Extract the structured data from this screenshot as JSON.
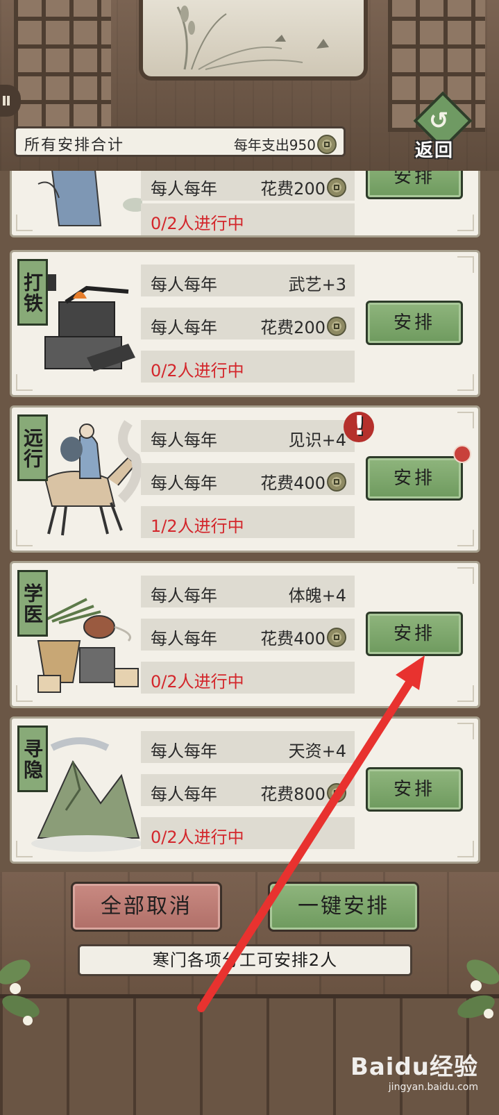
{
  "header": {
    "totals_label": "所有安排合计",
    "totals_expense": "每年支出950",
    "back_label": "返回"
  },
  "cards": [
    {
      "tag": "",
      "rows": [
        {
          "label": "每人每年",
          "value": "花费200"
        }
      ],
      "status": "0/2人进行中",
      "button": "安排"
    },
    {
      "tag": "打铁",
      "rows": [
        {
          "label": "每人每年",
          "value": "武艺+3"
        },
        {
          "label": "每人每年",
          "value": "花费200"
        }
      ],
      "status": "0/2人进行中",
      "button": "安排"
    },
    {
      "tag": "远行",
      "rows": [
        {
          "label": "每人每年",
          "value": "见识+4"
        },
        {
          "label": "每人每年",
          "value": "花费400"
        }
      ],
      "status": "1/2人进行中",
      "button": "安排",
      "alert": "!"
    },
    {
      "tag": "学医",
      "rows": [
        {
          "label": "每人每年",
          "value": "体魄+4"
        },
        {
          "label": "每人每年",
          "value": "花费400"
        }
      ],
      "status": "0/2人进行中",
      "button": "安排"
    },
    {
      "tag": "寻隐",
      "rows": [
        {
          "label": "每人每年",
          "value": "天资+4"
        },
        {
          "label": "每人每年",
          "value": "花费800"
        }
      ],
      "status": "0/2人进行中",
      "button": "安排"
    }
  ],
  "footer": {
    "cancel_all": "全部取消",
    "one_click": "一键安排",
    "notice": "寒门各项分工可安排2人"
  },
  "watermark": {
    "brand": "Baidu经验",
    "url": "jingyan.baidu.com"
  },
  "colors": {
    "status_red": "#d3262b",
    "button_green": "#7fa86e",
    "cancel_red": "#c07c74",
    "arrow_red": "#e8322f"
  }
}
